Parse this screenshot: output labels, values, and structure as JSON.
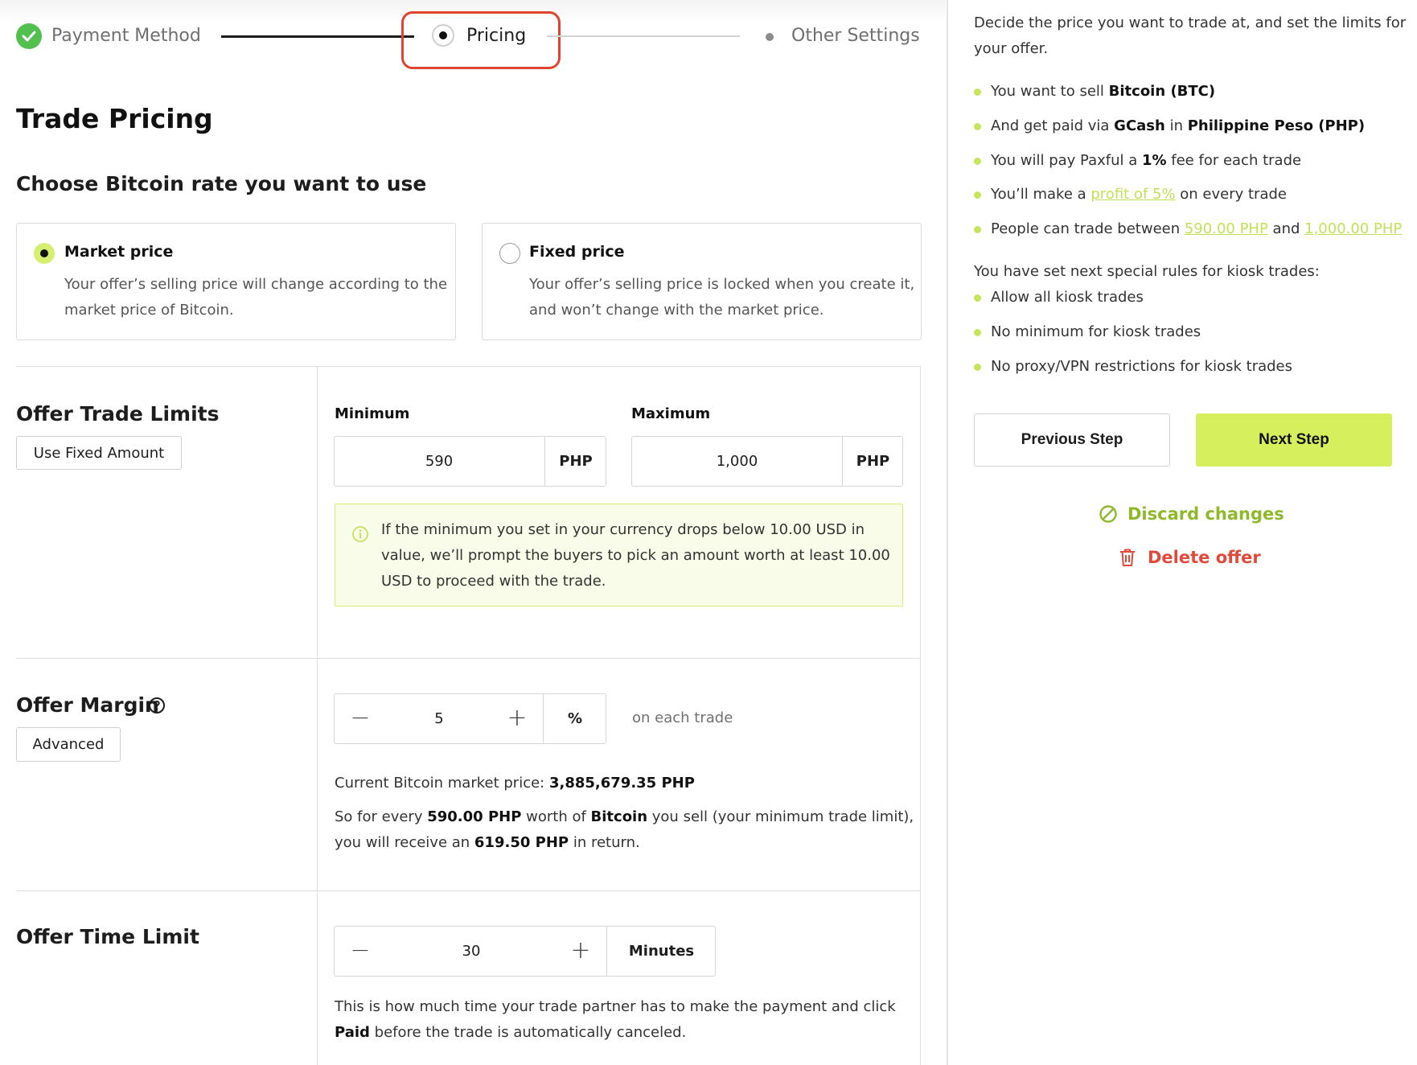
{
  "stepper": {
    "steps": [
      {
        "label": "Payment Method",
        "state": "done"
      },
      {
        "label": "Pricing",
        "state": "active"
      },
      {
        "label": "Other Settings",
        "state": "upcoming"
      }
    ]
  },
  "page": {
    "title": "Trade Pricing",
    "rate_heading": "Choose Bitcoin rate you want to use"
  },
  "rate_options": [
    {
      "title": "Market price",
      "desc_line1": "Your offer’s selling price will change according to the",
      "desc_line2": "market price of Bitcoin.",
      "selected": true
    },
    {
      "title": "Fixed price",
      "desc_line1": "Your offer’s selling price is locked when you create it,",
      "desc_line2": "and won’t change with the market price.",
      "selected": false
    }
  ],
  "limits": {
    "title": "Offer Trade Limits",
    "button": "Use Fixed Amount",
    "min_label": "Minimum",
    "min_value": "590",
    "min_currency": "PHP",
    "max_label": "Maximum",
    "max_value": "1,000",
    "max_currency": "PHP",
    "info_line1": "If the minimum you set in your currency drops below 10.00 USD in",
    "info_line2": "value, we’ll prompt the buyers to pick an amount worth at least 10.00",
    "info_line3": "USD to proceed with the trade."
  },
  "margin": {
    "title": "Offer Margin",
    "button": "Advanced",
    "value": "5",
    "unit": "%",
    "suffix_text": "on each trade",
    "market_label": "Current Bitcoin market price: ",
    "market_value": "3,885,679.35 PHP",
    "so_prefix": "So for every ",
    "so_amount": "590.00 PHP",
    "so_mid": " worth of ",
    "so_coin": "Bitcoin",
    "so_end": " you sell (your minimum trade limit),",
    "receive_prefix": "you will receive an ",
    "receive_amount": "619.50 PHP",
    "receive_end": " in return."
  },
  "time_limit": {
    "title": "Offer Time Limit",
    "value": "30",
    "unit": "Minutes",
    "desc_line1": "This is how much time your trade partner has to make the payment and click",
    "desc_bold": "Paid",
    "desc_line2_rest": " before the trade is automatically canceled."
  },
  "sidebar": {
    "intro_line1": "Decide the price you want to trade at, and set the limits for",
    "intro_line2": "your offer.",
    "b1_pre": "You want to sell ",
    "b1_bold": "Bitcoin (BTC)",
    "b2_pre": "And get paid via ",
    "b2_bold1": "GCash",
    "b2_mid": " in ",
    "b2_bold2": "Philippine Peso (PHP)",
    "b3_pre": "You will pay Paxful a ",
    "b3_bold": "1%",
    "b3_post": " fee for each trade",
    "b4_pre": "You’ll make a ",
    "b4_link": "profit of 5%",
    "b4_post": " on every trade",
    "b5_pre": "People can trade between ",
    "b5_link1": "590.00 PHP",
    "b5_mid": " and ",
    "b5_link2": "1,000.00 PHP",
    "rules_heading": "You have set next special rules for kiosk trades:",
    "rules": [
      "Allow all kiosk trades",
      "No minimum for kiosk trades",
      "No proxy/VPN restrictions for kiosk trades"
    ],
    "prev_button": "Previous Step",
    "next_button": "Next Step",
    "discard_label": "Discard changes",
    "delete_label": "Delete offer"
  },
  "colors": {
    "accent_lime": "#d6ef5c",
    "success_green": "#52c04f",
    "discard_green": "#8fb82b",
    "danger_red": "#e04a3a",
    "highlight_red": "#e0432f"
  }
}
